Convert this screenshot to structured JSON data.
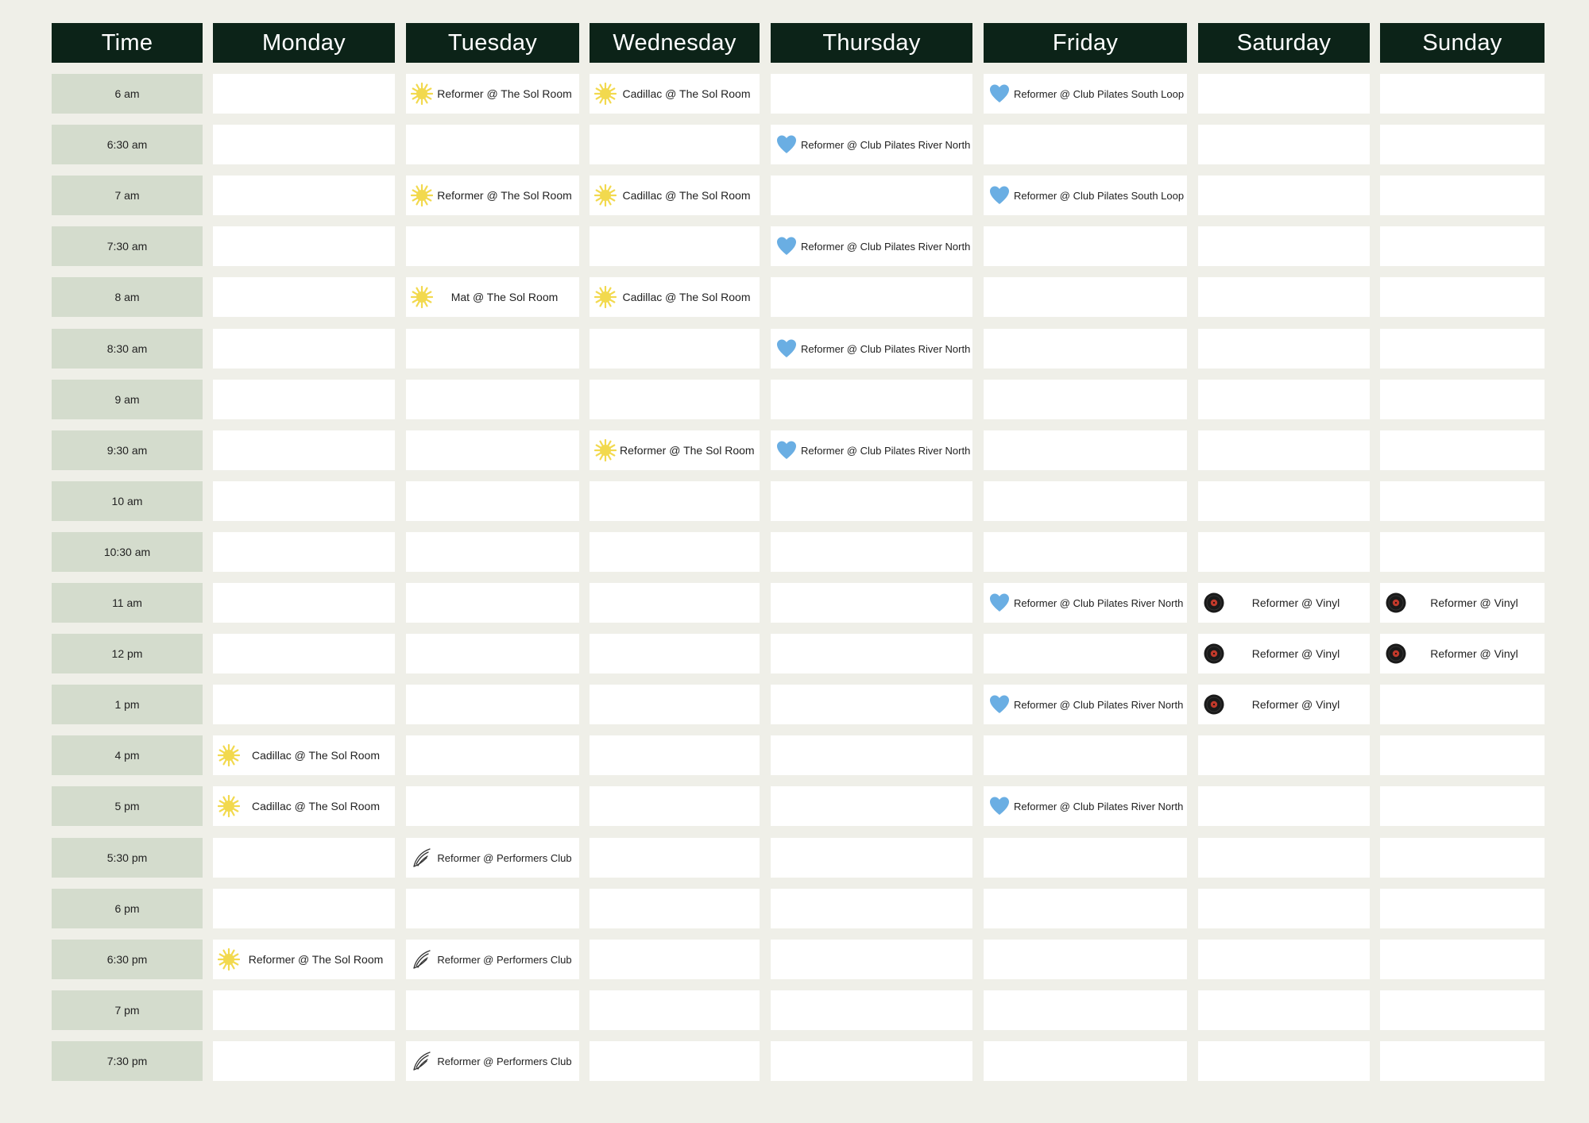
{
  "headers": [
    "Time",
    "Monday",
    "Tuesday",
    "Wednesday",
    "Thursday",
    "Friday",
    "Saturday",
    "Sunday"
  ],
  "times": [
    "6 am",
    "6:30 am",
    "7 am",
    "7:30 am",
    "8 am",
    "8:30 am",
    "9 am",
    "9:30 am",
    "10 am",
    "10:30 am",
    "11 am",
    "12 pm",
    "1 pm",
    "4 pm",
    "5 pm",
    "5:30 pm",
    "6 pm",
    "6:30 pm",
    "7 pm",
    "7:30 pm"
  ],
  "studios": {
    "sol": {
      "icon": "sun-icon",
      "color": "#f2d94e"
    },
    "clubpilates": {
      "icon": "heart-icon",
      "color": "#6aaee3"
    },
    "vinyl": {
      "icon": "vinyl-record-icon",
      "color": "#1a1a1a"
    },
    "performers": {
      "icon": "wing-icon",
      "color": "#333333"
    }
  },
  "colors": {
    "header_bg": "#0c2318",
    "time_bg": "#d4dccd",
    "cell_bg": "#ffffff",
    "page_bg": "#efefe8"
  },
  "classes": [
    {
      "day": "Tuesday",
      "time": "6 am",
      "label": "Reformer @ The Sol Room",
      "studio": "sol"
    },
    {
      "day": "Wednesday",
      "time": "6 am",
      "label": "Cadillac @ The Sol Room",
      "studio": "sol"
    },
    {
      "day": "Friday",
      "time": "6 am",
      "label": "Reformer @ Club Pilates South Loop",
      "studio": "clubpilates"
    },
    {
      "day": "Thursday",
      "time": "6:30 am",
      "label": "Reformer @ Club Pilates River North",
      "studio": "clubpilates"
    },
    {
      "day": "Tuesday",
      "time": "7 am",
      "label": "Reformer @ The Sol Room",
      "studio": "sol"
    },
    {
      "day": "Wednesday",
      "time": "7 am",
      "label": "Cadillac @ The Sol Room",
      "studio": "sol"
    },
    {
      "day": "Friday",
      "time": "7 am",
      "label": "Reformer @ Club Pilates South Loop",
      "studio": "clubpilates"
    },
    {
      "day": "Thursday",
      "time": "7:30 am",
      "label": "Reformer @ Club Pilates River North",
      "studio": "clubpilates"
    },
    {
      "day": "Tuesday",
      "time": "8 am",
      "label": "Mat @ The Sol Room",
      "studio": "sol"
    },
    {
      "day": "Wednesday",
      "time": "8 am",
      "label": "Cadillac @ The Sol Room",
      "studio": "sol"
    },
    {
      "day": "Thursday",
      "time": "8:30 am",
      "label": "Reformer @ Club Pilates River North",
      "studio": "clubpilates"
    },
    {
      "day": "Wednesday",
      "time": "9:30 am",
      "label": "Reformer @ The Sol Room",
      "studio": "sol"
    },
    {
      "day": "Thursday",
      "time": "9:30 am",
      "label": "Reformer @ Club Pilates River North",
      "studio": "clubpilates"
    },
    {
      "day": "Friday",
      "time": "11 am",
      "label": "Reformer @ Club Pilates River North",
      "studio": "clubpilates"
    },
    {
      "day": "Saturday",
      "time": "11 am",
      "label": "Reformer @ Vinyl",
      "studio": "vinyl"
    },
    {
      "day": "Sunday",
      "time": "11 am",
      "label": "Reformer @ Vinyl",
      "studio": "vinyl"
    },
    {
      "day": "Saturday",
      "time": "12 pm",
      "label": "Reformer @ Vinyl",
      "studio": "vinyl"
    },
    {
      "day": "Sunday",
      "time": "12 pm",
      "label": "Reformer @ Vinyl",
      "studio": "vinyl"
    },
    {
      "day": "Friday",
      "time": "1 pm",
      "label": "Reformer @ Club Pilates River North",
      "studio": "clubpilates"
    },
    {
      "day": "Saturday",
      "time": "1 pm",
      "label": "Reformer @ Vinyl",
      "studio": "vinyl"
    },
    {
      "day": "Monday",
      "time": "4 pm",
      "label": "Cadillac @ The Sol Room",
      "studio": "sol"
    },
    {
      "day": "Monday",
      "time": "5 pm",
      "label": "Cadillac @ The Sol Room",
      "studio": "sol"
    },
    {
      "day": "Friday",
      "time": "5 pm",
      "label": "Reformer @ Club Pilates River North",
      "studio": "clubpilates"
    },
    {
      "day": "Tuesday",
      "time": "5:30 pm",
      "label": "Reformer @ Performers Club",
      "studio": "performers"
    },
    {
      "day": "Monday",
      "time": "6:30 pm",
      "label": "Reformer @ The Sol Room",
      "studio": "sol"
    },
    {
      "day": "Tuesday",
      "time": "6:30 pm",
      "label": "Reformer @ Performers Club",
      "studio": "performers"
    },
    {
      "day": "Tuesday",
      "time": "7:30 pm",
      "label": "Reformer @ Performers Club",
      "studio": "performers"
    }
  ]
}
